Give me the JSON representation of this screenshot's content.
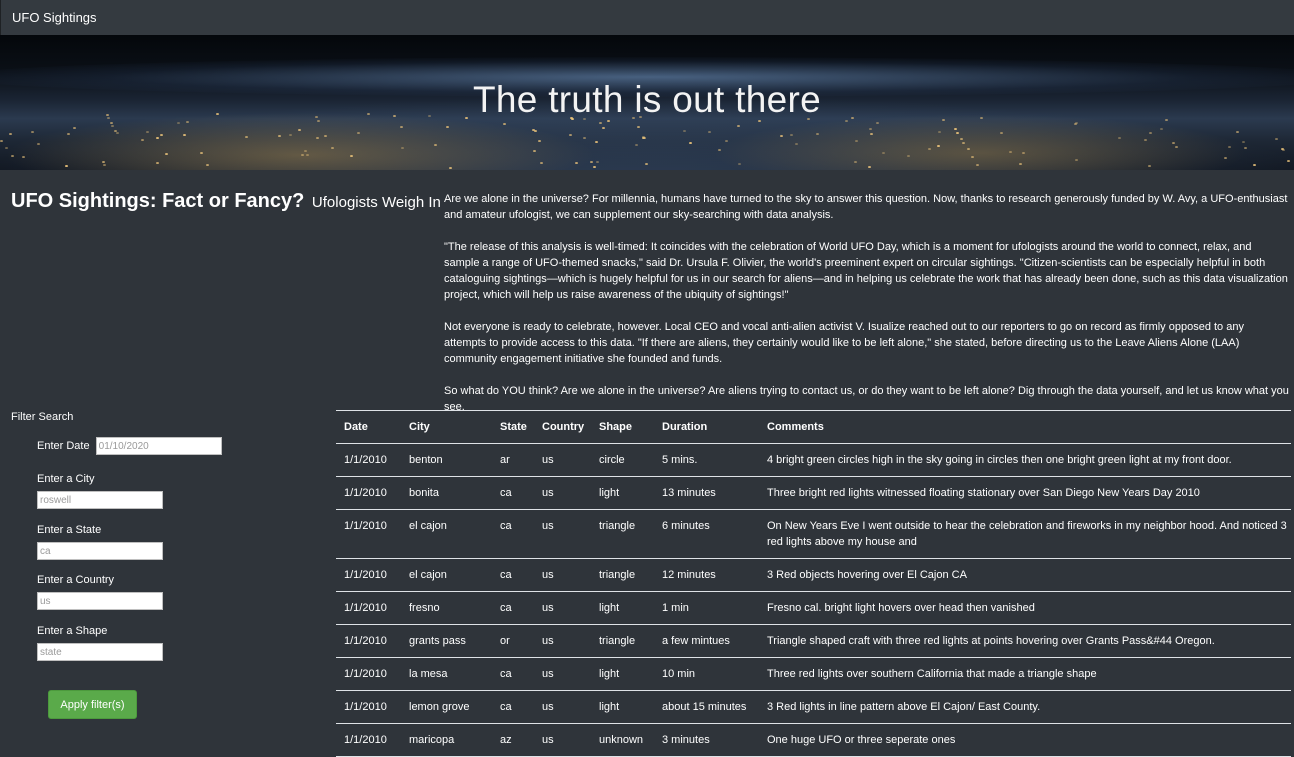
{
  "navbar": {
    "brand": "UFO Sightings"
  },
  "hero": {
    "title": "The truth is out there"
  },
  "article": {
    "title": "UFO Sightings: Fact or Fancy?",
    "subtitle": "Ufologists Weigh In",
    "paragraphs": [
      "Are we alone in the universe? For millennia, humans have turned to the sky to answer this question. Now, thanks to research generously funded by W. Avy, a UFO-enthusiast and amateur ufologist, we can supplement our sky-searching with data analysis.",
      "\"The release of this analysis is well-timed: It coincides with the celebration of World UFO Day, which is a moment for ufologists around the world to connect, relax, and sample a range of UFO-themed snacks,\" said Dr. Ursula F. Olivier, the world's preeminent expert on circular sightings. \"Citizen-scientists can be especially helpful in both cataloguing sightings—which is hugely helpful for us in our search for aliens—and in helping us celebrate the work that has already been done, such as this data visualization project, which will help us raise awareness of the ubiquity of sightings!\"",
      "Not everyone is ready to celebrate, however. Local CEO and vocal anti-alien activist V. Isualize reached out to our reporters to go on record as firmly opposed to any attempts to provide access to this data. \"If there are aliens, they certainly would like to be left alone,\" she stated, before directing us to the Leave Aliens Alone (LAA) community engagement initiative she founded and funds.",
      "So what do YOU think? Are we alone in the universe? Are aliens trying to contact us, or do they want to be left alone? Dig through the data yourself, and let us know what you see."
    ]
  },
  "filters": {
    "title": "Filter Search",
    "date": {
      "label": "Enter Date",
      "placeholder": "01/10/2020"
    },
    "city": {
      "label": "Enter a City",
      "placeholder": "roswell"
    },
    "state": {
      "label": "Enter a State",
      "placeholder": "ca"
    },
    "country": {
      "label": "Enter a Country",
      "placeholder": "us"
    },
    "shape": {
      "label": "Enter a Shape",
      "placeholder": "state"
    },
    "apply_label": "Apply filter(s)"
  },
  "table": {
    "headers": [
      "Date",
      "City",
      "State",
      "Country",
      "Shape",
      "Duration",
      "Comments"
    ],
    "rows": [
      [
        "1/1/2010",
        "benton",
        "ar",
        "us",
        "circle",
        "5 mins.",
        "4 bright green circles high in the sky going in circles then one bright green light at my front door."
      ],
      [
        "1/1/2010",
        "bonita",
        "ca",
        "us",
        "light",
        "13 minutes",
        "Three bright red lights witnessed floating stationary over San Diego New Years Day 2010"
      ],
      [
        "1/1/2010",
        "el cajon",
        "ca",
        "us",
        "triangle",
        "6 minutes",
        "On New Years Eve I went outside to hear the celebration and fireworks in my neighbor hood. And noticed 3 red lights above my house and"
      ],
      [
        "1/1/2010",
        "el cajon",
        "ca",
        "us",
        "triangle",
        "12 minutes",
        "3 Red objects hovering over El Cajon CA"
      ],
      [
        "1/1/2010",
        "fresno",
        "ca",
        "us",
        "light",
        "1 min",
        "Fresno cal. bright light hovers over head then vanished"
      ],
      [
        "1/1/2010",
        "grants pass",
        "or",
        "us",
        "triangle",
        "a few mintues",
        "Triangle shaped craft with three red lights at points hovering over Grants Pass&#44 Oregon."
      ],
      [
        "1/1/2010",
        "la mesa",
        "ca",
        "us",
        "light",
        "10 min",
        "Three red lights over southern California that made a triangle shape"
      ],
      [
        "1/1/2010",
        "lemon grove",
        "ca",
        "us",
        "light",
        "about 15 minutes",
        "3 Red lights in line pattern above El Cajon/ East County."
      ],
      [
        "1/1/2010",
        "maricopa",
        "az",
        "us",
        "unknown",
        "3 minutes",
        "One huge UFO or three seperate ones"
      ]
    ]
  }
}
